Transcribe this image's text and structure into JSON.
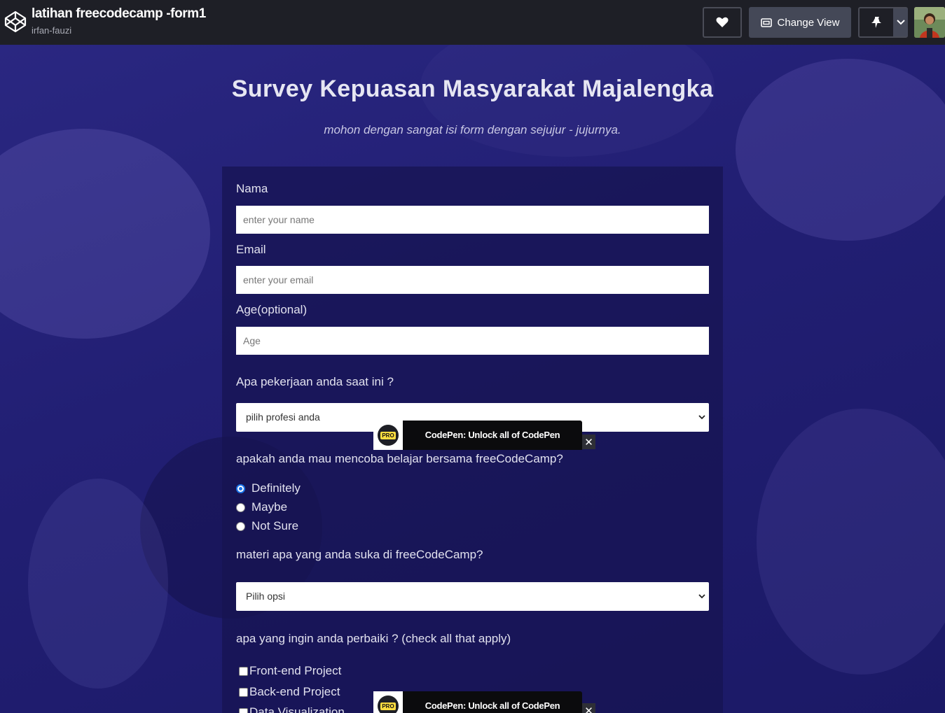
{
  "topbar": {
    "title": "latihan freecodecamp -form1",
    "user": "irfan-fauzi",
    "change_view_label": "Change View"
  },
  "page": {
    "title": "Survey Kepuasan Masyarakat Majalengka",
    "description": "mohon dengan sangat isi form dengan sejujur - jujurnya."
  },
  "form": {
    "name_label": "Nama",
    "name_placeholder": "enter your name",
    "email_label": "Email",
    "email_placeholder": "enter your email",
    "age_label": "Age(optional)",
    "age_placeholder": "Age",
    "job_question": "Apa pekerjaan anda saat ini ?",
    "job_selected": "pilih profesi anda",
    "learn_question": "apakah anda mau mencoba belajar bersama freeCodeCamp?",
    "learn_options": [
      {
        "label": "Definitely",
        "checked": true
      },
      {
        "label": "Maybe",
        "checked": false
      },
      {
        "label": "Not Sure",
        "checked": false
      }
    ],
    "material_question": "materi apa yang anda suka di freeCodeCamp?",
    "material_selected": "Pilih opsi",
    "improve_question": "apa yang ingin anda perbaiki ? (check all that apply)",
    "improve_options": [
      {
        "label": "Front-end Project",
        "checked": false
      },
      {
        "label": "Back-end Project",
        "checked": false
      },
      {
        "label": "Data Visualization",
        "checked": false
      }
    ]
  },
  "promo": {
    "badge": "PRO",
    "text": "CodePen: Unlock all of CodePen",
    "close": "✕"
  },
  "colors": {
    "topbar": "#1e1f26",
    "background": "#221f74",
    "radio_accent": "#1a73e8",
    "pro_badge": "#ffdd40"
  }
}
